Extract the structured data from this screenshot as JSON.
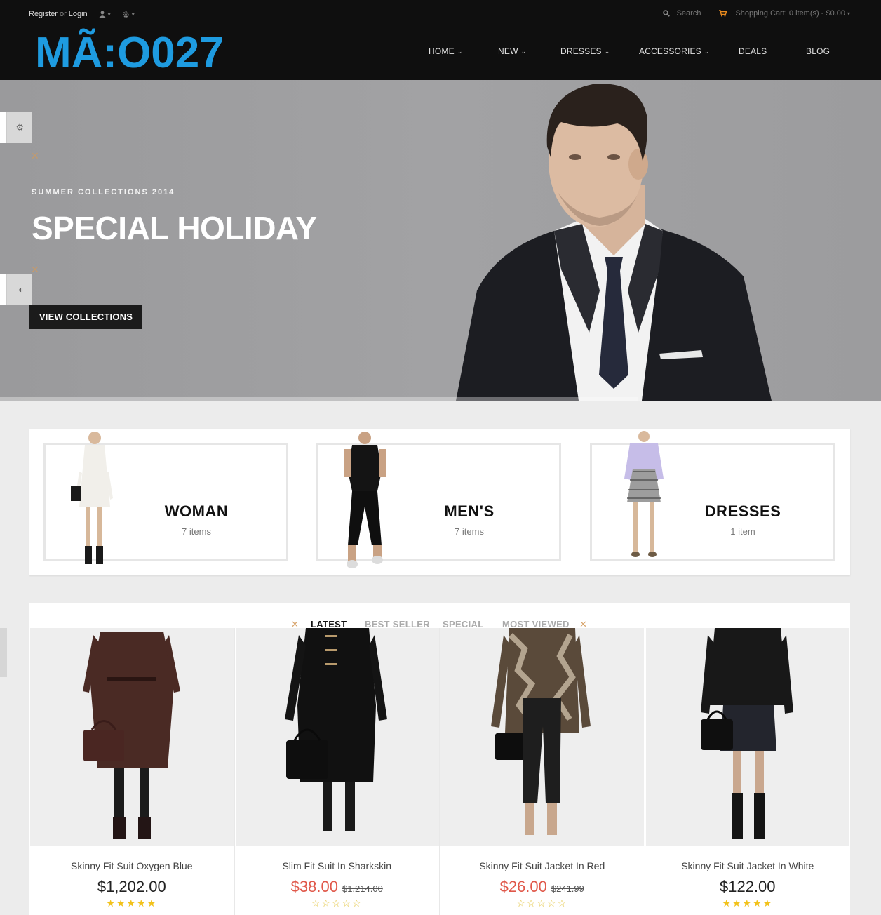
{
  "topbar": {
    "register": "Register",
    "or": "or",
    "login": "Login",
    "search_label": "Search",
    "cart_label": "Shopping Cart: 0 item(s) - $0.00"
  },
  "logo": {
    "text": "MÃ:O027"
  },
  "nav": {
    "items": [
      {
        "label": "HOME",
        "dropdown": true
      },
      {
        "label": "NEW",
        "dropdown": true
      },
      {
        "label": "DRESSES",
        "dropdown": true
      },
      {
        "label": "ACCESSORIES",
        "dropdown": true
      },
      {
        "label": "DEALS",
        "dropdown": false
      },
      {
        "label": "BLOG",
        "dropdown": false
      }
    ]
  },
  "hero": {
    "subtitle": "SUMMER COLLECTIONS 2014",
    "title": "SPECIAL HOLIDAY",
    "button": "VIEW COLLECTIONS"
  },
  "categories": [
    {
      "name": "WOMAN",
      "count": "7 items"
    },
    {
      "name": "MEN'S",
      "count": "7 items"
    },
    {
      "name": "DRESSES",
      "count": "1 item"
    }
  ],
  "tabs": [
    {
      "label": "LATEST",
      "active": true
    },
    {
      "label": "BEST SELLER",
      "active": false
    },
    {
      "label": "SPECIAL",
      "active": false
    },
    {
      "label": "MOST VIEWED",
      "active": false
    }
  ],
  "products": [
    {
      "name": "Skinny Fit Suit Oxygen Blue",
      "price": "$1,202.00",
      "old_price": "",
      "rating": 5
    },
    {
      "name": "Slim Fit Suit In Sharkskin",
      "price": "$38.00",
      "old_price": "$1,214.00",
      "rating": 0
    },
    {
      "name": "Skinny Fit Suit Jacket In Red",
      "price": "$26.00",
      "old_price": "$241.99",
      "rating": 0
    },
    {
      "name": "Skinny Fit Suit Jacket In White",
      "price": "$122.00",
      "old_price": "",
      "rating": 5
    }
  ],
  "colors": {
    "logo": "#1e9be0",
    "header_bg": "#0f0f0f",
    "sale_price": "#e0584a",
    "star": "#f2c21b",
    "accent_x": "#c49a6c"
  }
}
